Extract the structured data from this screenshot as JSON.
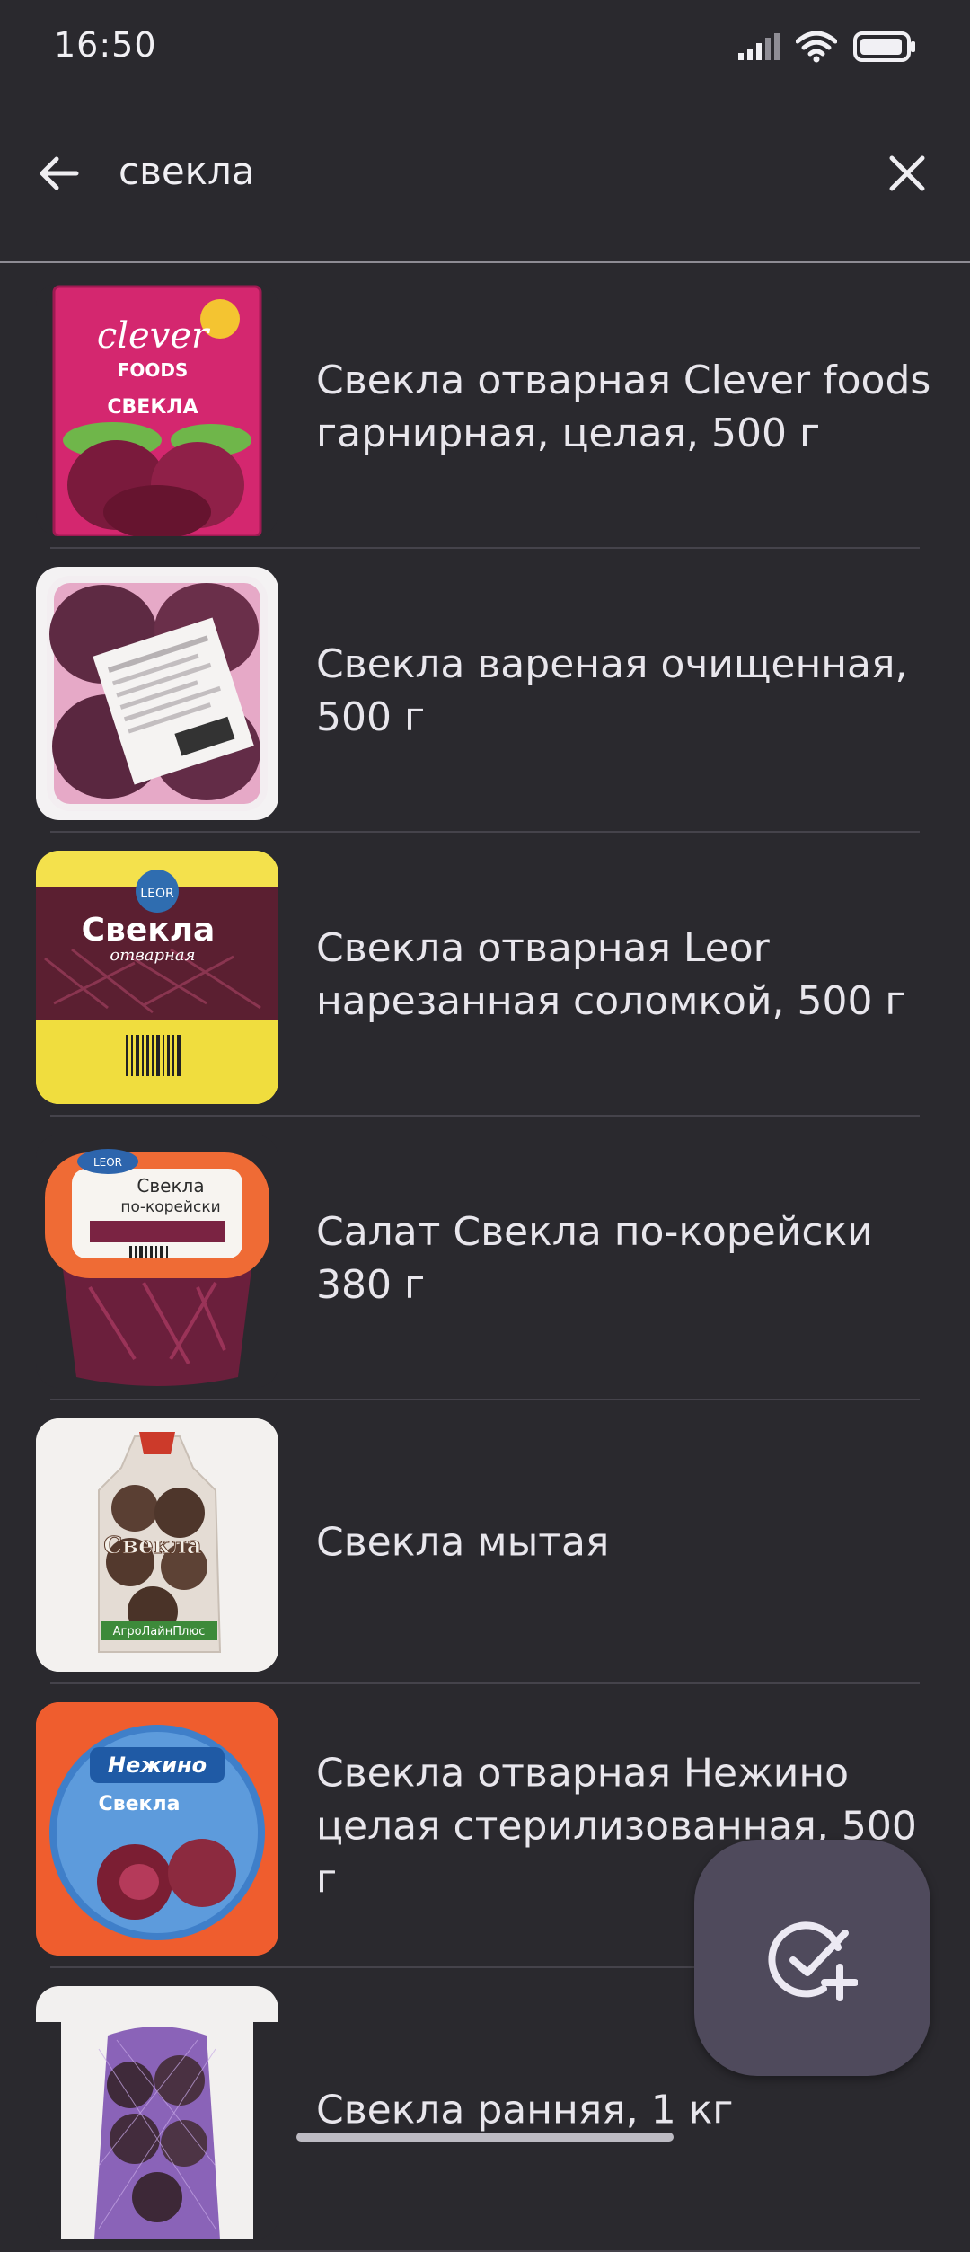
{
  "status_bar": {
    "time": "16:50"
  },
  "search": {
    "query": "свекла"
  },
  "results": [
    {
      "title": "Свекла отварная Clever foods гарнирная, целая, 500 г"
    },
    {
      "title": "Свекла вареная очищенная, 500 г"
    },
    {
      "title": "Свекла отварная Leor нарезанная соломкой, 500 г"
    },
    {
      "title": "Салат Свекла по-корейски 380 г"
    },
    {
      "title": "Свекла мытая"
    },
    {
      "title": "Свекла отварная Нежино целая стерилизованная, 500 г"
    },
    {
      "title": "Свекла ранняя, 1 кг"
    }
  ],
  "thumb_labels": {
    "clever_brand": "clever",
    "clever_foods": "FOODS",
    "clever_product": "СВЕКЛА",
    "leor_brand": "LEOR",
    "leor_product": "Свекла",
    "leor_sub": "отварная",
    "korean_brand": "LEOR",
    "korean_product": "Свекла",
    "korean_sub": "по-корейски",
    "washed_product": "Свекла",
    "washed_brand": "АгроЛайнПлюс",
    "nezhino_brand": "Нежино",
    "nezhino_product": "Свекла"
  },
  "colors": {
    "background": "#2a292e",
    "divider": "#45434b",
    "fab": "#4f4a5c",
    "text": "#e8e6ec"
  },
  "icons": [
    "arrow-back-icon",
    "close-icon",
    "signal-icon",
    "wifi-icon",
    "battery-icon",
    "check-add-icon"
  ]
}
